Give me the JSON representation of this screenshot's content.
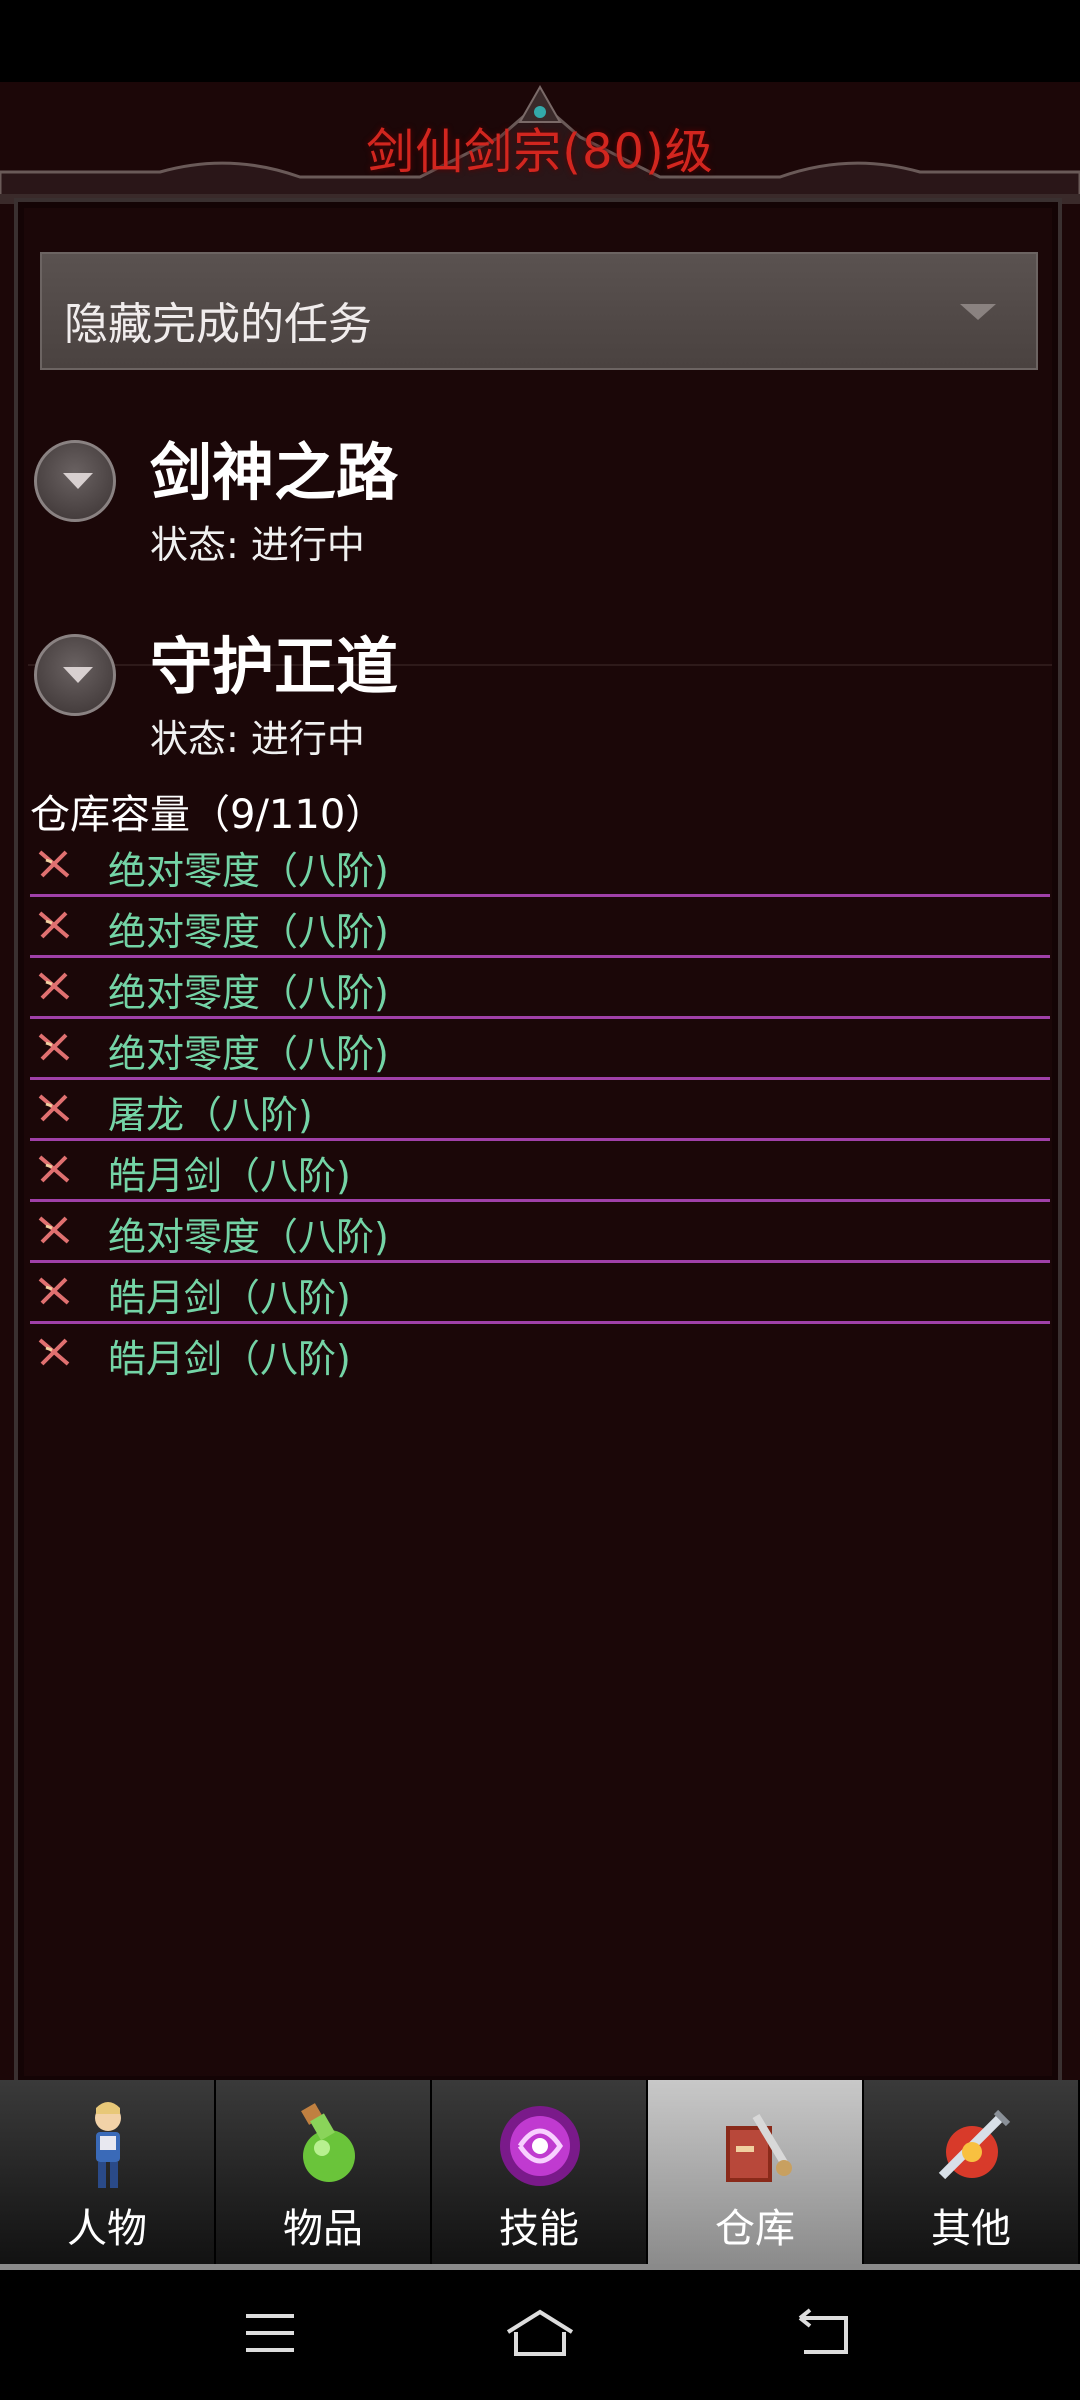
{
  "header": {
    "title": "剑仙剑宗(80)级"
  },
  "filter": {
    "label": "隐藏完成的任务"
  },
  "tasks": [
    {
      "title": "剑神之路",
      "status": "状态: 进行中"
    },
    {
      "title": "守护正道",
      "status": "状态: 进行中"
    }
  ],
  "warehouse": {
    "capacity": "仓库容量（9/110）",
    "items": [
      "绝对零度（八阶)",
      "绝对零度（八阶)",
      "绝对零度（八阶)",
      "绝对零度（八阶)",
      "屠龙（八阶)",
      "皓月剑（八阶)",
      "绝对零度（八阶)",
      "皓月剑（八阶)",
      "皓月剑（八阶)"
    ]
  },
  "tabs": [
    {
      "label": "人物",
      "icon": "character-icon"
    },
    {
      "label": "物品",
      "icon": "potion-icon"
    },
    {
      "label": "技能",
      "icon": "skill-orb-icon"
    },
    {
      "label": "仓库",
      "icon": "warehouse-icon",
      "active": true
    },
    {
      "label": "其他",
      "icon": "other-icon"
    }
  ],
  "colors": {
    "title": "#d2261f",
    "item_text": "#74d4a6",
    "item_divider": "#a040a8"
  }
}
